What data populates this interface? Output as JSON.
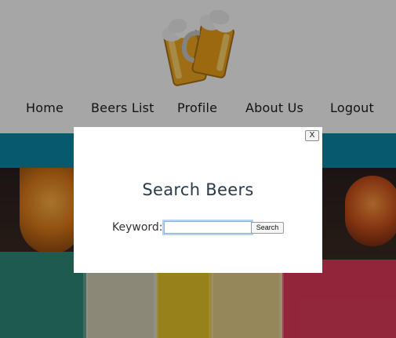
{
  "nav": {
    "items": [
      {
        "label": "Home"
      },
      {
        "label": "Beers List"
      },
      {
        "label": "Profile"
      },
      {
        "label": "About Us"
      },
      {
        "label": "Logout"
      }
    ]
  },
  "logo": {
    "icon": "beer-mugs-icon"
  },
  "modal": {
    "close_label": "X",
    "title": "Search Beers",
    "keyword_label": "Keyword:",
    "keyword_value": "",
    "search_label": "Search"
  },
  "colors": {
    "banner": "#0b89a8",
    "title": "#2b3a4a"
  }
}
